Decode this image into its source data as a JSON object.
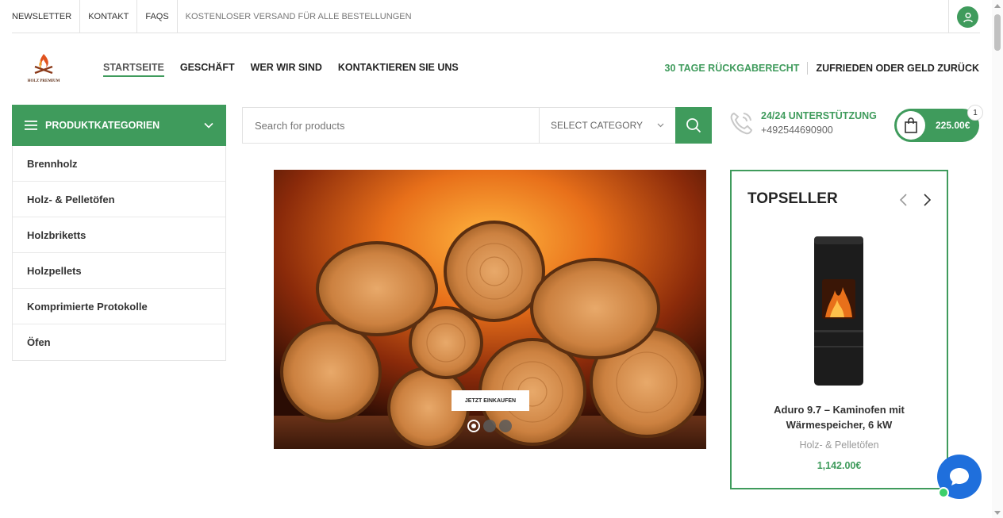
{
  "topbar": {
    "links": [
      "NEWSLETTER",
      "KONTAKT",
      "FAQS"
    ],
    "promo": "KOSTENLOSER VERSAND FÜR ALLE BESTELLUNGEN",
    "account_icon": "user-icon"
  },
  "header": {
    "logo_text": "HOLZ PREMIUM",
    "nav": [
      "STARTSEITE",
      "GESCHÄFT",
      "WER WIR SIND",
      "KONTAKTIEREN SIE UNS"
    ],
    "active_nav": "STARTSEITE",
    "right_green": "30 TAGE RÜCKGABERECHT",
    "right_dark": "ZUFRIEDEN ODER GELD ZURÜCK"
  },
  "categories": {
    "title": "PRODUKTKATEGORIEN",
    "items": [
      "Brennholz",
      "Holz- & Pelletöfen",
      "Holzbriketts",
      "Holzpellets",
      "Komprimierte Protokolle",
      "Öfen"
    ]
  },
  "search": {
    "placeholder": "Search for products",
    "category_label": "SELECT CATEGORY"
  },
  "support": {
    "title": "24/24 UNTERSTÜTZUNG",
    "phone": "+492544690900"
  },
  "cart": {
    "amount": "225.00€",
    "count": "1"
  },
  "slider": {
    "button": "JETZT EINKAUFEN",
    "slides": 3,
    "active_slide": 1
  },
  "topseller": {
    "title": "TOPSELLER",
    "product_name": "Aduro 9.7 – Kaminofen mit Wärmespeicher, 6 kW",
    "product_category": "Holz- & Pelletöfen",
    "product_price": "1,142.00€"
  },
  "colors": {
    "accent": "#3f9b5c",
    "chat": "#1f6fdc"
  }
}
